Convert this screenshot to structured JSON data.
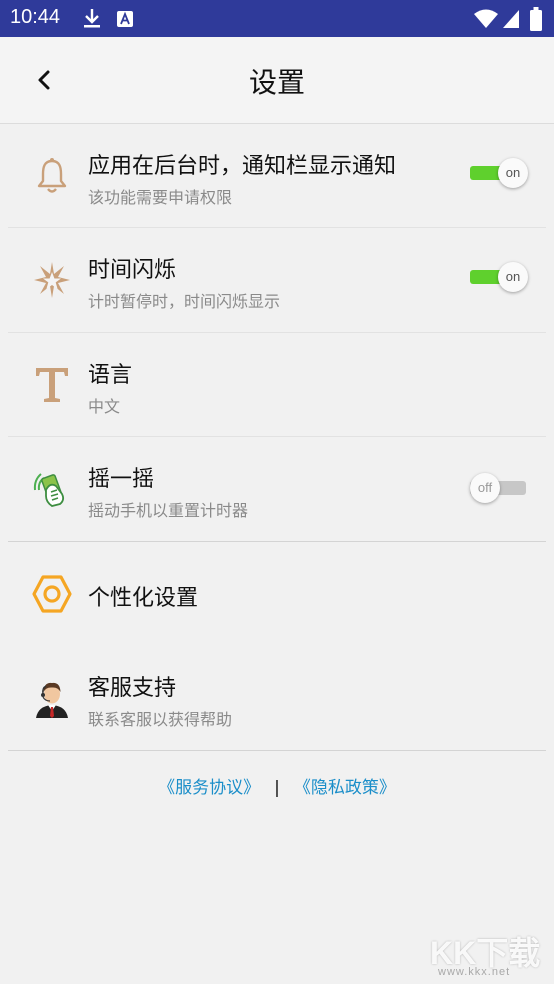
{
  "status_bar": {
    "time": "10:44"
  },
  "header": {
    "title": "设置"
  },
  "settings": [
    {
      "title": "应用在后台时，通知栏显示通知",
      "subtitle": "该功能需要申请权限",
      "toggle": "on"
    },
    {
      "title": "时间闪烁",
      "subtitle": "计时暂停时，时间闪烁显示",
      "toggle": "on"
    },
    {
      "title": "语言",
      "subtitle": "中文"
    },
    {
      "title": "摇一摇",
      "subtitle": "摇动手机以重置计时器",
      "toggle": "off"
    },
    {
      "title": "个性化设置"
    },
    {
      "title": "客服支持",
      "subtitle": "联系客服以获得帮助"
    }
  ],
  "footer": {
    "service_agreement": "《服务协议》",
    "separator": "|",
    "privacy_policy": "《隐私政策》"
  },
  "watermark": {
    "text": "KK下载",
    "url": "www.kkx.net"
  },
  "colors": {
    "status_bar": "#2f3a9a",
    "toggle_on": "#5fd02d",
    "toggle_off": "#c7c7c7",
    "link": "#1b8ec9",
    "icon_brown": "#c9a07a",
    "icon_orange": "#f5a623",
    "icon_green": "#4caf50"
  }
}
